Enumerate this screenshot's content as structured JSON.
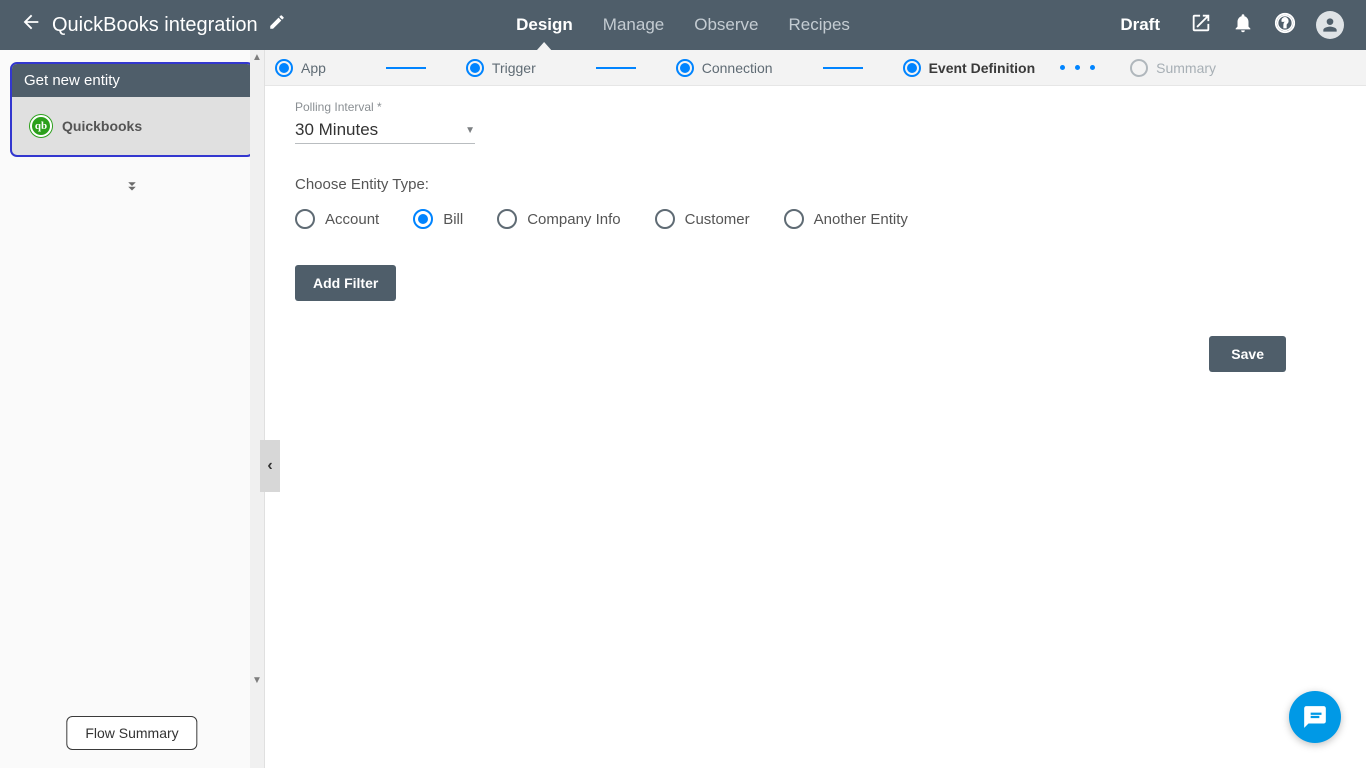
{
  "header": {
    "title": "QuickBooks integration",
    "status": "Draft",
    "tabs": [
      {
        "label": "Design",
        "active": true
      },
      {
        "label": "Manage",
        "active": false
      },
      {
        "label": "Observe",
        "active": false
      },
      {
        "label": "Recipes",
        "active": false
      }
    ]
  },
  "sidebar": {
    "card_title": "Get new entity",
    "card_item": "Quickbooks",
    "flow_summary": "Flow Summary"
  },
  "stepper": {
    "steps": [
      {
        "label": "App",
        "state": "done"
      },
      {
        "label": "Trigger",
        "state": "done"
      },
      {
        "label": "Connection",
        "state": "done"
      },
      {
        "label": "Event Definition",
        "state": "active"
      },
      {
        "label": "Summary",
        "state": "disabled"
      }
    ]
  },
  "form": {
    "polling_label": "Polling Interval *",
    "polling_value": "30 Minutes",
    "entity_label": "Choose Entity Type:",
    "entity_options": [
      {
        "label": "Account",
        "selected": false
      },
      {
        "label": "Bill",
        "selected": true
      },
      {
        "label": "Company Info",
        "selected": false
      },
      {
        "label": "Customer",
        "selected": false
      },
      {
        "label": "Another Entity",
        "selected": false
      }
    ],
    "add_filter": "Add Filter",
    "save": "Save"
  }
}
